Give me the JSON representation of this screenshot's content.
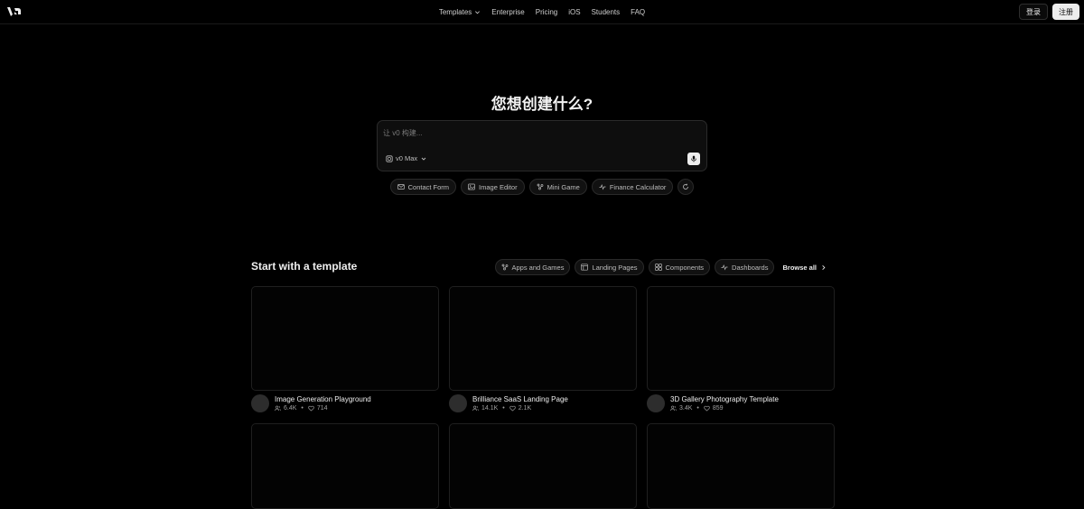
{
  "header": {
    "nav": [
      {
        "label": "Templates",
        "has_dropdown": true
      },
      {
        "label": "Enterprise"
      },
      {
        "label": "Pricing"
      },
      {
        "label": "iOS"
      },
      {
        "label": "Students"
      },
      {
        "label": "FAQ"
      }
    ],
    "login_label": "登录",
    "signup_label": "注册"
  },
  "hero": {
    "title": "您想创建什么?",
    "prompt_placeholder": "让 v0 构建...",
    "model_label": "v0 Max"
  },
  "suggestions": [
    {
      "label": "Contact Form",
      "icon": "mail-icon"
    },
    {
      "label": "Image Editor",
      "icon": "image-icon"
    },
    {
      "label": "Mini Game",
      "icon": "game-icon"
    },
    {
      "label": "Finance Calculator",
      "icon": "pulse-icon"
    }
  ],
  "templates": {
    "title": "Start with a template",
    "filters": [
      {
        "label": "Apps and Games",
        "icon": "apps-icon"
      },
      {
        "label": "Landing Pages",
        "icon": "layout-icon"
      },
      {
        "label": "Components",
        "icon": "grid-icon"
      },
      {
        "label": "Dashboards",
        "icon": "pulse-icon"
      }
    ],
    "browse_label": "Browse all",
    "cards": [
      {
        "title": "Image Generation Playground",
        "users": "6.4K",
        "likes": "714"
      },
      {
        "title": "Brilliance SaaS Landing Page",
        "users": "14.1K",
        "likes": "2.1K"
      },
      {
        "title": "3D Gallery Photography Template",
        "users": "3.4K",
        "likes": "859"
      }
    ]
  },
  "colors": {
    "background": "#000000",
    "text": "#ededed",
    "muted": "#a0a0a0",
    "border": "#2a2a2a"
  }
}
